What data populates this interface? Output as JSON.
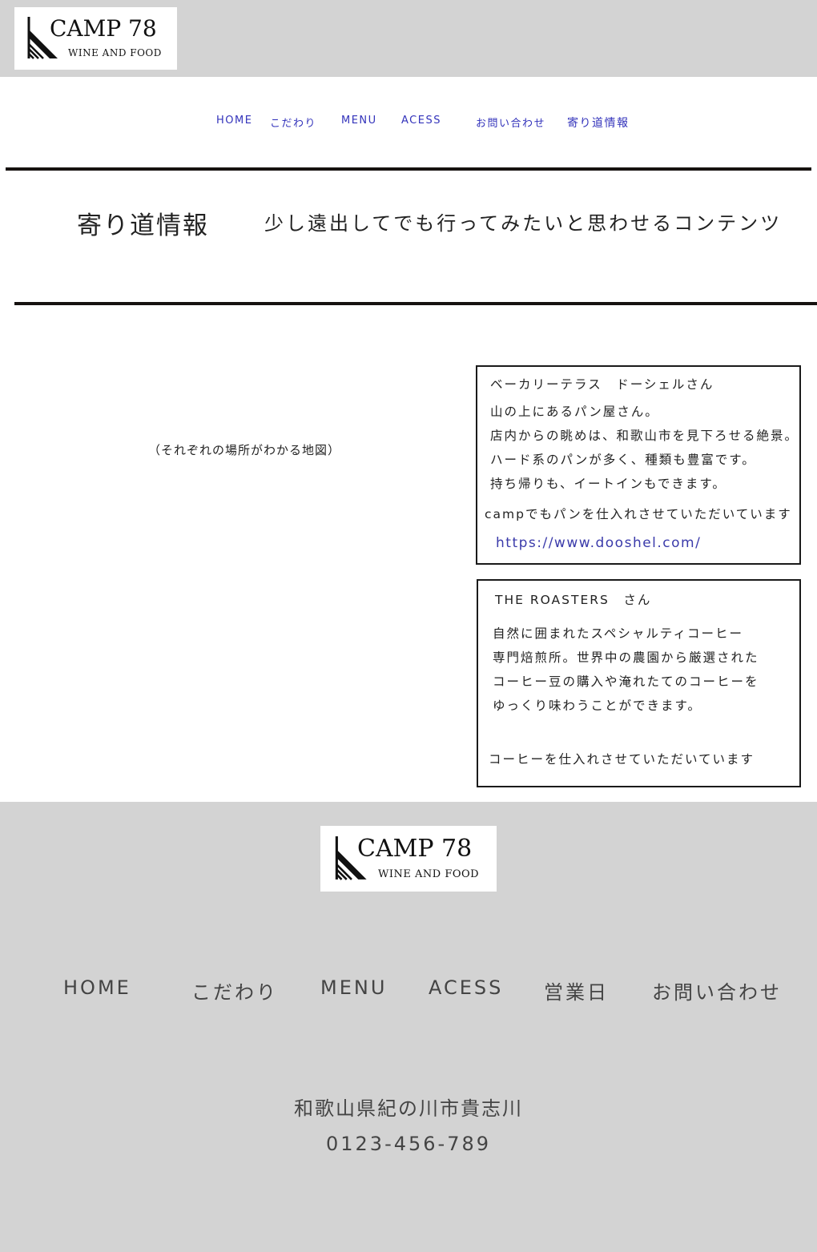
{
  "brand": {
    "name": "CAMP 78",
    "tagline": "WINE AND FOOD"
  },
  "nav": {
    "items": [
      "HOME",
      "こだわり",
      "MENU",
      "ACESS",
      "お問い合わせ",
      "寄り道情報"
    ],
    "link_color": "#3333bb"
  },
  "page": {
    "title": "寄り道情報",
    "lead": "少し遠出してでも行ってみたいと思わせるコンテンツ",
    "map_placeholder": "（それぞれの場所がわかる地図）"
  },
  "spots": [
    {
      "name": "ベーカリーテラス　ドーシェルさん",
      "description": [
        "山の上にあるパン屋さん。",
        "店内からの眺めは、和歌山市を見下ろせる絶景。",
        "ハード系のパンが多く、種類も豊富です。",
        "持ち帰りも、イートインもできます。"
      ],
      "note": "campでもパンを仕入れさせていただいています",
      "url": "https://www.dooshel.com/"
    },
    {
      "name": "THE ROASTERS　さん",
      "description": [
        "自然に囲まれたスペシャルティコーヒー",
        "専門焙煎所。世界中の農園から厳選された",
        "コーヒー豆の購入や淹れたてのコーヒーを",
        "ゆっくり味わうことができます。"
      ],
      "note": "コーヒーを仕入れさせていただいています"
    }
  ],
  "footer": {
    "nav": [
      "HOME",
      "こだわり",
      "MENU",
      "ACESS",
      "営業日",
      "お問い合わせ"
    ],
    "address": "和歌山県紀の川市貴志川",
    "phone": "0123-456-789",
    "background": "#d3d3d3"
  }
}
